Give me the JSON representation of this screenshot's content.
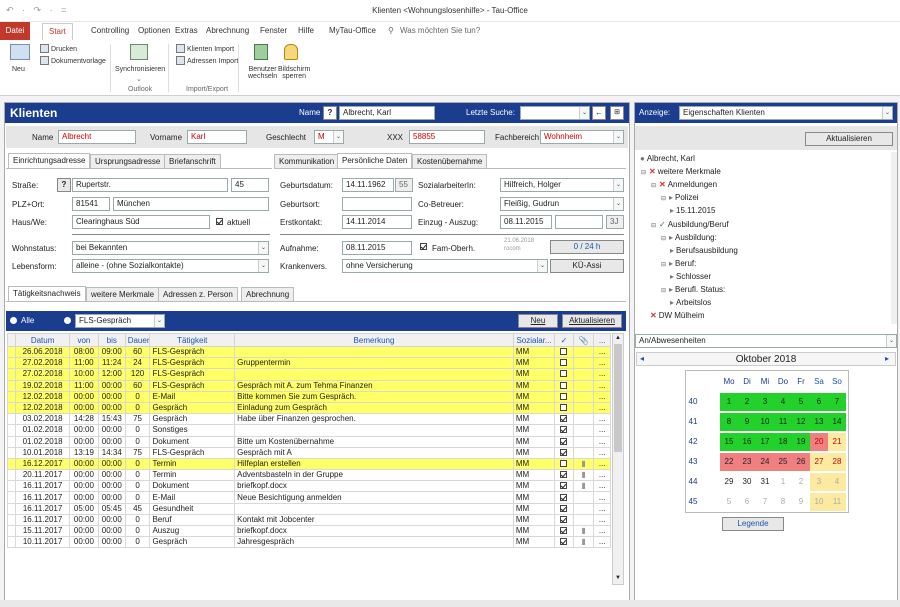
{
  "window": {
    "title": "Klienten <Wohnungslosenhilfe> - Tau-Office",
    "qat": "↶ · ↷ · ="
  },
  "menu": {
    "datei": "Datei",
    "start": "Start",
    "items": [
      "Controlling",
      "Optionen",
      "Extras",
      "Abrechnung",
      "Fenster",
      "Hilfe",
      "MyTau-Office"
    ],
    "search": "Was möchten Sie tun?"
  },
  "ribbon": {
    "neu": "Neu",
    "drucken": "Drucken",
    "dokumentvorlage": "Dokumentvorlage",
    "synchronisieren": "Synchronisieren",
    "outlook_group": "Outlook",
    "klienten_import": "Klienten Import",
    "adressen_import": "Adressen Import",
    "import_group": "Import/Export",
    "benutzer": "Benutzer",
    "wechseln": "wechseln",
    "bildschirm": "Bildschirm",
    "sperren": "sperren"
  },
  "klienten": {
    "title": "Klienten",
    "name_label": "Name",
    "name_help": "?",
    "name_value": "Albrecht, Karl",
    "letzte_suche_label": "Letzte Suche:",
    "letzte_suche_value": "",
    "back_arrow": "←",
    "name_field_label": "Name",
    "name_field_value": "Albrecht",
    "vorname_label": "Vorname",
    "vorname_value": "Karl",
    "geschlecht_label": "Geschlecht",
    "geschlecht_value": "M",
    "xxx_label": "XXX",
    "xxx_value": "58855",
    "fachbereich_label": "Fachbereich",
    "fachbereich_value": "Wohnheim"
  },
  "address_tabs": [
    "Einrichtungsadresse",
    "Ursprungsadresse",
    "Briefanschrift"
  ],
  "address": {
    "strasse_label": "Straße:",
    "strasse_value": "Rupertstr.",
    "hausnr": "45",
    "plz_label": "PLZ+Ort:",
    "plz_value": "81541",
    "ort_value": "München",
    "haus_label": "Haus/We:",
    "haus_value": "Clearinghaus Süd",
    "aktuell_label": "aktuell",
    "wohnstatus_label": "Wohnstatus:",
    "wohnstatus_value": "bei Bekannten",
    "lebensform_label": "Lebensform:",
    "lebensform_value": "alleine - (ohne Sozialkontakte)"
  },
  "detail_tabs": [
    "Kommunikation",
    "Persönliche Daten",
    "Kostenübernahme"
  ],
  "personal": {
    "geburtsdatum_label": "Geburtsdatum:",
    "geburtsdatum_value": "14.11.1962",
    "age": "55",
    "geburtsort_label": "Geburtsort:",
    "geburtsort_value": "",
    "erstkontakt_label": "Erstkontakt:",
    "erstkontakt_value": "14.11.2014",
    "sozialarbeiter_label": "SozialarbeiterIn:",
    "sozialarbeiter_value": "Hilfreich, Holger",
    "cobetreuer_label": "Co-Betreuer:",
    "cobetreuer_value": "Fleißig, Gudrun",
    "einzug_label": "Einzug - Auszug:",
    "einzug_value": "08.11.2015",
    "einzug_days": "3J",
    "aufnahme_label": "Aufnahme:",
    "aufnahme_value": "08.11.2015",
    "fam_label": "Fam-Oberh.",
    "fam_date": "21.06.2018",
    "fam_user": "rocom",
    "hours": "0 / 24 h",
    "kranken_label": "Krankenvers.",
    "kranken_value": "ohne Versicherung",
    "ku_button": "KÜ-Assi"
  },
  "lower_tabs": [
    "Tätigkeitsnachweis",
    "weitere Merkmale",
    "Adressen z. Person",
    "Abrechnung"
  ],
  "activity_bar": {
    "alle": "Alle",
    "filter": "FLS-Gespräch",
    "neu": "Neu",
    "aktualisieren": "Aktualisieren"
  },
  "table": {
    "headers": [
      "Datum",
      "von",
      "bis",
      "Dauer",
      "Tätigkeit",
      "Bemerkung",
      "Sozialar...",
      "✓",
      "📎",
      "..."
    ],
    "rows": [
      {
        "datum": "26.06.2018",
        "von": "08:00",
        "bis": "09:00",
        "dauer": "60",
        "taet": "FLS-Gespräch",
        "bem": "",
        "soz": "MM",
        "chk": false,
        "att": false,
        "yellow": true
      },
      {
        "datum": "27.02.2018",
        "von": "11:00",
        "bis": "11:24",
        "dauer": "24",
        "taet": "FLS-Gespräch",
        "bem": "Gruppentermin",
        "soz": "MM",
        "chk": false,
        "att": false,
        "yellow": true
      },
      {
        "datum": "27.02.2018",
        "von": "10:00",
        "bis": "12:00",
        "dauer": "120",
        "taet": "FLS-Gespräch",
        "bem": "",
        "soz": "MM",
        "chk": false,
        "att": false,
        "yellow": true
      },
      {
        "datum": "19.02.2018",
        "von": "11:00",
        "bis": "00:00",
        "dauer": "60",
        "taet": "FLS-Gespräch",
        "bem": "Gespräch mit A. zum Tehma Finanzen",
        "soz": "MM",
        "chk": false,
        "att": false,
        "yellow": true
      },
      {
        "datum": "12.02.2018",
        "von": "00:00",
        "bis": "00:00",
        "dauer": "0",
        "taet": "E-Mail",
        "bem": "Bitte kommen Sie zum Gespräch.",
        "soz": "MM",
        "chk": false,
        "att": false,
        "yellow": true
      },
      {
        "datum": "12.02.2018",
        "von": "00:00",
        "bis": "00:00",
        "dauer": "0",
        "taet": "Gespräch",
        "bem": "Einladung zum Gespräch",
        "soz": "MM",
        "chk": false,
        "att": false,
        "yellow": true
      },
      {
        "datum": "03.02.2018",
        "von": "14:28",
        "bis": "15:43",
        "dauer": "75",
        "taet": "Gespräch",
        "bem": "Habe über Finanzen gesprochen.",
        "soz": "MM",
        "chk": true,
        "att": false,
        "yellow": false
      },
      {
        "datum": "01.02.2018",
        "von": "00:00",
        "bis": "00:00",
        "dauer": "0",
        "taet": "Sonstiges",
        "bem": "",
        "soz": "MM",
        "chk": true,
        "att": false,
        "yellow": false
      },
      {
        "datum": "01.02.2018",
        "von": "00:00",
        "bis": "00:00",
        "dauer": "0",
        "taet": "Dokument",
        "bem": "Bitte um Kostenübernahme",
        "soz": "MM",
        "chk": true,
        "att": false,
        "yellow": false
      },
      {
        "datum": "10.01.2018",
        "von": "13:19",
        "bis": "14:34",
        "dauer": "75",
        "taet": "FLS-Gespräch",
        "bem": "Gespräch mit A",
        "soz": "MM",
        "chk": true,
        "att": false,
        "yellow": false
      },
      {
        "datum": "16.12.2017",
        "von": "00:00",
        "bis": "00:00",
        "dauer": "0",
        "taet": "Termin",
        "bem": "Hilfeplan erstellen",
        "soz": "MM",
        "chk": false,
        "att": true,
        "yellow": true
      },
      {
        "datum": "20.11.2017",
        "von": "00:00",
        "bis": "00:00",
        "dauer": "0",
        "taet": "Termin",
        "bem": "Adventsbasteln in der Gruppe",
        "soz": "MM",
        "chk": true,
        "att": true,
        "yellow": false
      },
      {
        "datum": "16.11.2017",
        "von": "00:00",
        "bis": "00:00",
        "dauer": "0",
        "taet": "Dokument",
        "bem": "briefkopf.docx",
        "soz": "MM",
        "chk": true,
        "att": true,
        "yellow": false
      },
      {
        "datum": "16.11.2017",
        "von": "00:00",
        "bis": "00:00",
        "dauer": "0",
        "taet": "E-Mail",
        "bem": "Neue Besichtigung anmelden",
        "soz": "MM",
        "chk": true,
        "att": false,
        "yellow": false
      },
      {
        "datum": "16.11.2017",
        "von": "05:00",
        "bis": "05:45",
        "dauer": "45",
        "taet": "Gesundheit",
        "bem": "",
        "soz": "MM",
        "chk": true,
        "att": false,
        "yellow": false
      },
      {
        "datum": "16.11.2017",
        "von": "00:00",
        "bis": "00:00",
        "dauer": "0",
        "taet": "Beruf",
        "bem": "Kontakt mit Jobcenter",
        "soz": "MM",
        "chk": true,
        "att": false,
        "yellow": false
      },
      {
        "datum": "15.11.2017",
        "von": "00:00",
        "bis": "00:00",
        "dauer": "0",
        "taet": "Auszug",
        "bem": "briefkopf.docx",
        "soz": "MM",
        "chk": true,
        "att": true,
        "yellow": false
      },
      {
        "datum": "10.11.2017",
        "von": "00:00",
        "bis": "00:00",
        "dauer": "0",
        "taet": "Gespräch",
        "bem": "Jahresgespräch",
        "soz": "MM",
        "chk": true,
        "att": true,
        "yellow": false
      }
    ]
  },
  "right": {
    "anzeige_label": "Anzeige:",
    "anzeige_value": "Eigenschaften Klienten",
    "aktualisieren": "Aktualisieren",
    "tree": [
      {
        "text": "Albrecht, Karl",
        "level": 0,
        "icon": "person-icon"
      },
      {
        "text": "weitere Merkmale",
        "level": 0,
        "icon": "x-icon",
        "exp": "⊟"
      },
      {
        "text": "Anmeldungen",
        "level": 1,
        "icon": "x-icon",
        "exp": "⊟"
      },
      {
        "text": "Polizei",
        "level": 2,
        "icon": "arrow-icon",
        "exp": "⊟"
      },
      {
        "text": "15.11.2015",
        "level": 3,
        "icon": "arrow-icon"
      },
      {
        "text": "Ausbildung/Beruf",
        "level": 1,
        "icon": "check-icon",
        "exp": "⊟"
      },
      {
        "text": "Ausbildung:",
        "level": 2,
        "icon": "arrow-icon",
        "exp": "⊟"
      },
      {
        "text": "Berufsausbildung",
        "level": 3,
        "icon": "arrow-icon"
      },
      {
        "text": "Beruf:",
        "level": 2,
        "icon": "arrow-icon",
        "exp": "⊟"
      },
      {
        "text": "Schlosser",
        "level": 3,
        "icon": "arrow-icon"
      },
      {
        "text": "Berufl. Status:",
        "level": 2,
        "icon": "arrow-icon",
        "exp": "⊟"
      },
      {
        "text": "Arbeitslos",
        "level": 3,
        "icon": "arrow-icon"
      },
      {
        "text": "DW Mülheim",
        "level": 1,
        "icon": "x-icon"
      }
    ],
    "an_abwesenheiten": "An/Abwesenheiten",
    "calendar": {
      "month": "Oktober 2018",
      "weekdays": [
        "Mo",
        "Di",
        "Mi",
        "Do",
        "Fr",
        "Sa",
        "So"
      ],
      "weeks": [
        {
          "kw": "40",
          "days": [
            [
              "1",
              "g"
            ],
            [
              "2",
              "g"
            ],
            [
              "3",
              "g"
            ],
            [
              "4",
              "g"
            ],
            [
              "5",
              "g"
            ],
            [
              "6",
              "g"
            ],
            [
              "7",
              "g"
            ]
          ]
        },
        {
          "kw": "41",
          "days": [
            [
              "8",
              "g"
            ],
            [
              "9",
              "g"
            ],
            [
              "10",
              "g"
            ],
            [
              "11",
              "g"
            ],
            [
              "12",
              "g"
            ],
            [
              "13",
              "g"
            ],
            [
              "14",
              "g"
            ]
          ]
        },
        {
          "kw": "42",
          "days": [
            [
              "15",
              "g"
            ],
            [
              "16",
              "g"
            ],
            [
              "17",
              "g"
            ],
            [
              "18",
              "g"
            ],
            [
              "19",
              "g"
            ],
            [
              "20",
              "r"
            ],
            [
              "21",
              "ye"
            ]
          ]
        },
        {
          "kw": "43",
          "days": [
            [
              "22",
              "r"
            ],
            [
              "23",
              "r"
            ],
            [
              "24",
              "r"
            ],
            [
              "25",
              "r"
            ],
            [
              "26",
              "r"
            ],
            [
              "27",
              "ye"
            ],
            [
              "28",
              "ye"
            ]
          ]
        },
        {
          "kw": "44",
          "days": [
            [
              "29",
              ""
            ],
            [
              "30",
              ""
            ],
            [
              "31",
              ""
            ],
            [
              "1",
              "grey"
            ],
            [
              "2",
              "grey"
            ],
            [
              "3",
              "ye grey"
            ],
            [
              "4",
              "ye grey"
            ]
          ]
        },
        {
          "kw": "45",
          "days": [
            [
              "5",
              "grey"
            ],
            [
              "6",
              "grey"
            ],
            [
              "7",
              "grey"
            ],
            [
              "8",
              "grey"
            ],
            [
              "9",
              "grey"
            ],
            [
              "10",
              "ye grey"
            ],
            [
              "11",
              "ye grey"
            ]
          ]
        }
      ],
      "legend": "Legende"
    }
  }
}
